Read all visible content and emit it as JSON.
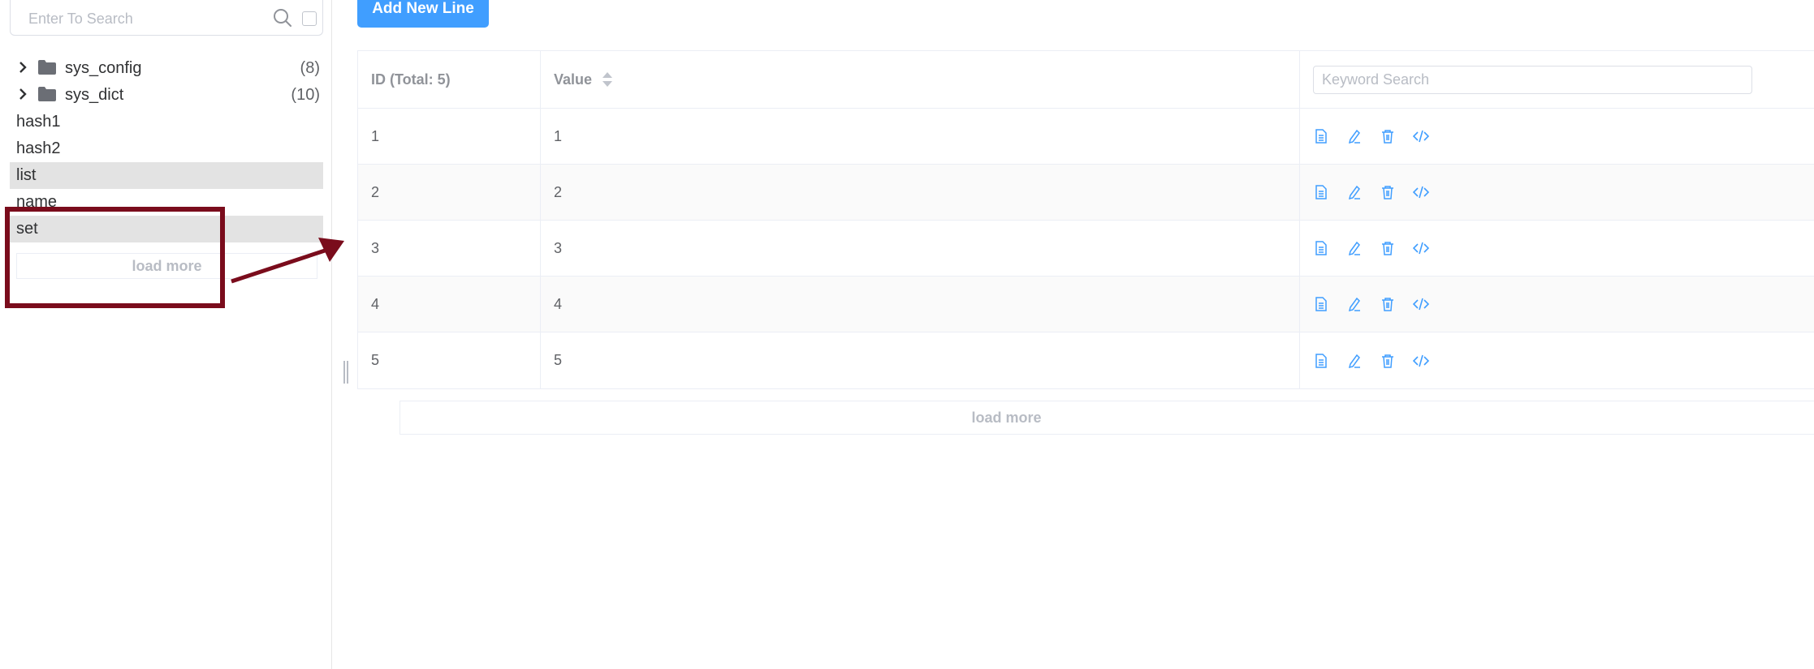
{
  "sidebar": {
    "search": {
      "placeholder": "Enter To Search",
      "value": ""
    },
    "folders": [
      {
        "name": "sys_config",
        "count": "(8)"
      },
      {
        "name": "sys_dict",
        "count": "(10)"
      }
    ],
    "keys": [
      {
        "name": "hash1",
        "selected": false
      },
      {
        "name": "hash2",
        "selected": false
      },
      {
        "name": "list",
        "selected": true
      },
      {
        "name": "name",
        "selected": false
      },
      {
        "name": "set",
        "selected": true
      }
    ],
    "load_more": "load more"
  },
  "toolbar": {
    "add_label": "Add New Line"
  },
  "table": {
    "headers": {
      "id": "ID (Total: 5)",
      "value": "Value",
      "search_placeholder": "Keyword Search"
    },
    "rows": [
      {
        "id": "1",
        "value": "1"
      },
      {
        "id": "2",
        "value": "2"
      },
      {
        "id": "3",
        "value": "3"
      },
      {
        "id": "4",
        "value": "4"
      },
      {
        "id": "5",
        "value": "5"
      }
    ],
    "actions": [
      "view-icon",
      "edit-icon",
      "delete-icon",
      "code-icon"
    ],
    "load_more": "load more"
  },
  "colors": {
    "accent": "#409eff",
    "annotation": "#7a0c1c",
    "selected_row": "#e3e3e3"
  }
}
